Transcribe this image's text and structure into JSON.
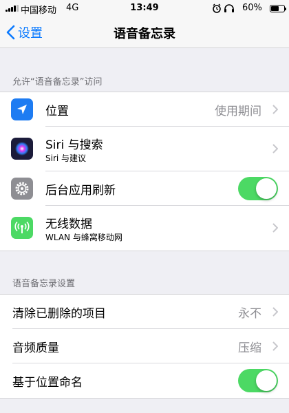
{
  "status_bar": {
    "carrier": "中国移动",
    "network": "4G",
    "time": "13:49",
    "battery_percent": "60%",
    "battery_level": 0.6,
    "icons": [
      "signal-icon",
      "alarm-icon",
      "headphones-icon",
      "battery-icon"
    ]
  },
  "nav": {
    "back_label": "设置",
    "title": "语音备忘录"
  },
  "section1": {
    "header": "允许“语音备忘录”访问",
    "rows": [
      {
        "icon": "location-arrow-icon",
        "icon_color": "#1e7cf2",
        "label": "位置",
        "value": "使用期间",
        "accessory": "chevron"
      },
      {
        "icon": "siri-icon",
        "icon_color": "#1b1b3a",
        "label": "Siri 与搜索",
        "sublabel": "Siri 与建议",
        "accessory": "chevron"
      },
      {
        "icon": "gear-icon",
        "icon_color": "#8e8e93",
        "label": "后台应用刷新",
        "accessory": "toggle",
        "toggle_on": true
      },
      {
        "icon": "cellular-antenna-icon",
        "icon_color": "#4cd964",
        "label": "无线数据",
        "sublabel": "WLAN 与蜂窝移动网",
        "accessory": "chevron"
      }
    ]
  },
  "section2": {
    "header": "语音备忘录设置",
    "rows": [
      {
        "label": "清除已删除的项目",
        "value": "永不",
        "accessory": "chevron"
      },
      {
        "label": "音频质量",
        "value": "压缩",
        "accessory": "chevron"
      },
      {
        "label": "基于位置命名",
        "accessory": "toggle",
        "toggle_on": true
      }
    ]
  },
  "colors": {
    "accent": "#0a7aff",
    "toggle_on": "#4cd964",
    "background": "#efeff4"
  }
}
